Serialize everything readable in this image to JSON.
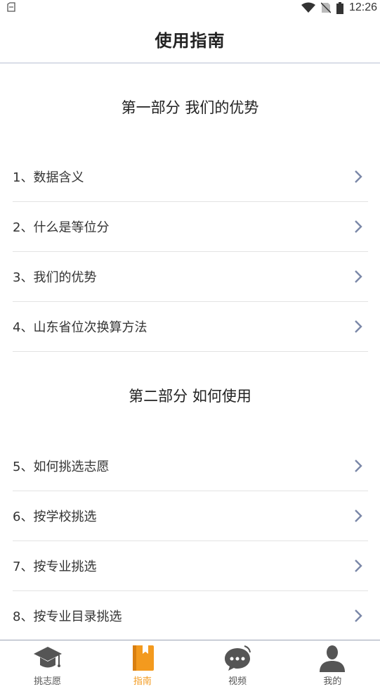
{
  "status_bar": {
    "time": "12:26",
    "left_icon": "clipboard-icon",
    "icons": [
      "wifi-icon",
      "no-sim-icon",
      "battery-icon"
    ]
  },
  "header": {
    "title": "使用指南"
  },
  "sections": [
    {
      "title": "第一部分 我们的优势",
      "items": [
        {
          "label": "1、数据含义"
        },
        {
          "label": "2、什么是等位分"
        },
        {
          "label": "3、我们的优势"
        },
        {
          "label": "4、山东省位次换算方法"
        }
      ]
    },
    {
      "title": "第二部分 如何使用",
      "items": [
        {
          "label": "5、如何挑选志愿"
        },
        {
          "label": "6、按学校挑选"
        },
        {
          "label": "7、按专业挑选"
        },
        {
          "label": "8、按专业目录挑选"
        }
      ]
    }
  ],
  "tab_bar": {
    "tabs": [
      {
        "label": "挑志愿",
        "icon": "graduation-cap-icon",
        "active": false
      },
      {
        "label": "指南",
        "icon": "book-icon",
        "active": true
      },
      {
        "label": "视频",
        "icon": "chat-bubble-icon",
        "active": false
      },
      {
        "label": "我的",
        "icon": "person-icon",
        "active": false
      }
    ]
  },
  "colors": {
    "accent": "#f39a1e",
    "icon_gray": "#555555",
    "chevron": "#7b88a8",
    "divider": "#e3e3e3"
  }
}
